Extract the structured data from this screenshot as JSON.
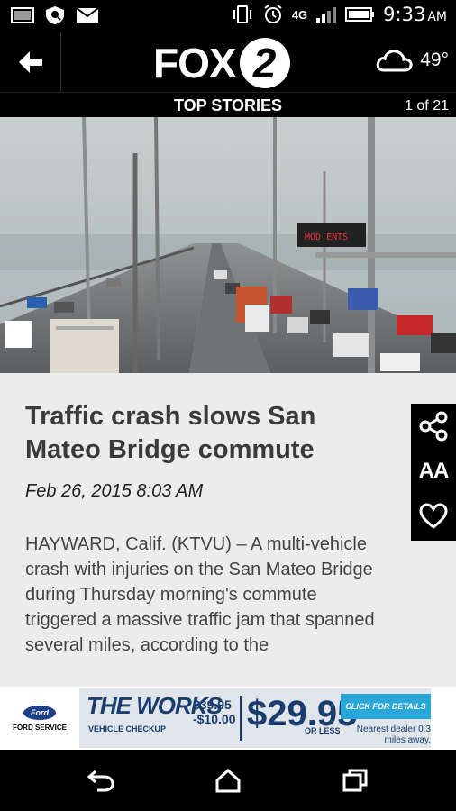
{
  "status_bar": {
    "time": "9:33",
    "ampm": "AM",
    "network": "4G"
  },
  "header": {
    "logo_text": "FOX",
    "logo_number": "2",
    "weather_temp": "49°"
  },
  "section": {
    "title": "TOP STORIES",
    "counter": "1 of 21"
  },
  "article": {
    "headline": "Traffic crash slows San Mateo Bridge commute",
    "date": "Feb 26, 2015 8:03 AM",
    "body": "HAYWARD, Calif. (KTVU) – A multi-vehicle crash with injuries on the San Mateo Bridge during Thursday morning's commute triggered a massive traffic jam that spanned several miles, according to the"
  },
  "actions": {
    "font_size_label": "AA"
  },
  "ad": {
    "ford_brand": "Ford",
    "ford_service": "FORD SERVICE",
    "works_title": "THE WORKS",
    "works_sub": "VEHICLE CHECKUP",
    "price_orig": "$39.95",
    "price_minus": "-$10.00",
    "price_main": "$29.95",
    "or_less": "OR LESS",
    "cta": "CLICK FOR DETAILS",
    "nearest": "Nearest dealer 0.3 miles away."
  },
  "colors": {
    "header_bg": "#000000",
    "article_bg": "#ececec",
    "headline": "#3a3a3a",
    "ad_cta": "#2aa6d8",
    "ad_blue": "#1a3d6d"
  }
}
